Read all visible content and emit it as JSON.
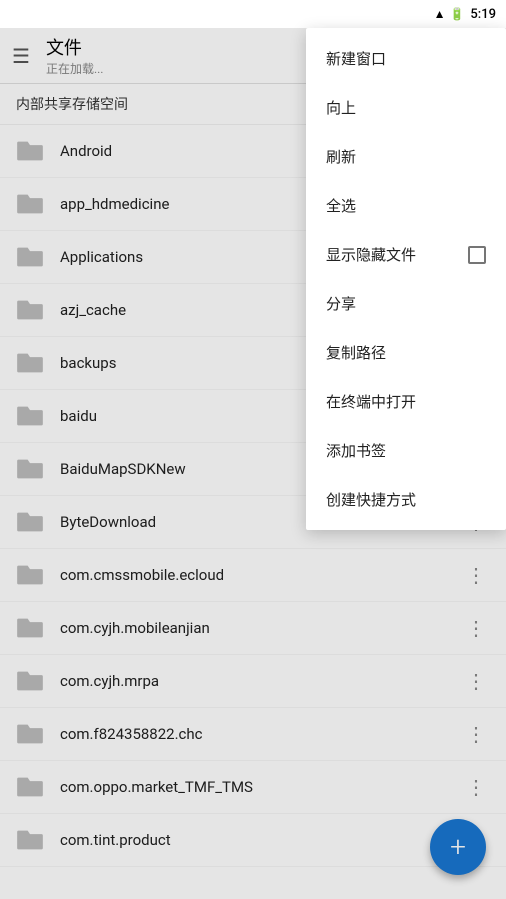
{
  "statusBar": {
    "time": "5:19",
    "batteryIcon": "🔋",
    "wifiIcon": "▲",
    "simIcon": "📶"
  },
  "topBar": {
    "hamburgerIcon": "☰",
    "title": "文件",
    "subtitle": "正在加载..."
  },
  "locationBar": {
    "path": "内部共享存储空间"
  },
  "files": [
    {
      "name": "Android",
      "showMore": false
    },
    {
      "name": "app_hdmedicine",
      "showMore": false
    },
    {
      "name": "Applications",
      "showMore": false
    },
    {
      "name": "azj_cache",
      "showMore": false
    },
    {
      "name": "backups",
      "showMore": false
    },
    {
      "name": "baidu",
      "showMore": false
    },
    {
      "name": "BaiduMapSDKNew",
      "showMore": true
    },
    {
      "name": "ByteDownload",
      "showMore": true
    },
    {
      "name": "com.cmssmobile.ecloud",
      "showMore": true
    },
    {
      "name": "com.cyjh.mobileanjian",
      "showMore": true
    },
    {
      "name": "com.cyjh.mrpa",
      "showMore": true
    },
    {
      "name": "com.f824358822.chc",
      "showMore": true
    },
    {
      "name": "com.oppo.market_TMF_TMS",
      "showMore": true
    },
    {
      "name": "com.tint.product",
      "showMore": true
    }
  ],
  "dropdown": {
    "items": [
      {
        "label": "新建窗口",
        "hasCheckbox": false
      },
      {
        "label": "向上",
        "hasCheckbox": false
      },
      {
        "label": "刷新",
        "hasCheckbox": false
      },
      {
        "label": "全选",
        "hasCheckbox": false
      },
      {
        "label": "显示隐藏文件",
        "hasCheckbox": true
      },
      {
        "label": "分享",
        "hasCheckbox": false
      },
      {
        "label": "复制路径",
        "hasCheckbox": false
      },
      {
        "label": "在终端中打开",
        "hasCheckbox": false
      },
      {
        "label": "添加书签",
        "hasCheckbox": false
      },
      {
        "label": "创建快捷方式",
        "hasCheckbox": false
      }
    ]
  },
  "fab": {
    "label": "+"
  }
}
